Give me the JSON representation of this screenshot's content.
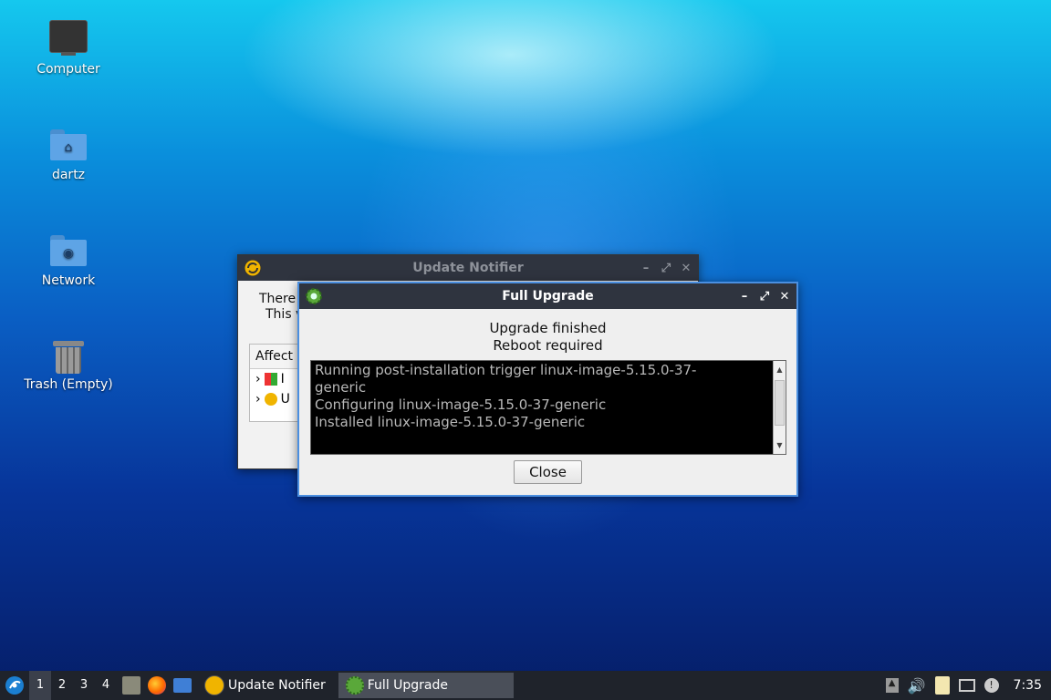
{
  "desktop": {
    "icons": [
      {
        "label": "Computer"
      },
      {
        "label": "dartz"
      },
      {
        "label": "Network"
      },
      {
        "label": "Trash (Empty)"
      }
    ]
  },
  "notifier_window": {
    "title": "Update Notifier",
    "line1": "There",
    "line2": "This v",
    "tree_header": "Affect",
    "tree_items": [
      "I",
      "U"
    ]
  },
  "upgrade_window": {
    "title": "Full Upgrade",
    "status_line1": "Upgrade finished",
    "status_line2": "Reboot required",
    "log_lines": [
      "Running post-installation trigger linux-image-5.15.0-37-",
      "generic",
      "Configuring linux-image-5.15.0-37-generic",
      "Installed linux-image-5.15.0-37-generic"
    ],
    "close_label": "Close"
  },
  "taskbar": {
    "workspaces": [
      "1",
      "2",
      "3",
      "4"
    ],
    "active_workspace": "1",
    "tasks": [
      {
        "label": "Update Notifier",
        "active": false
      },
      {
        "label": "Full Upgrade",
        "active": true
      }
    ],
    "clock": "7:35"
  },
  "colors": {
    "titlebar": "#2f343f",
    "focus_border": "#4b8fe0",
    "taskbar": "#1f232b"
  }
}
